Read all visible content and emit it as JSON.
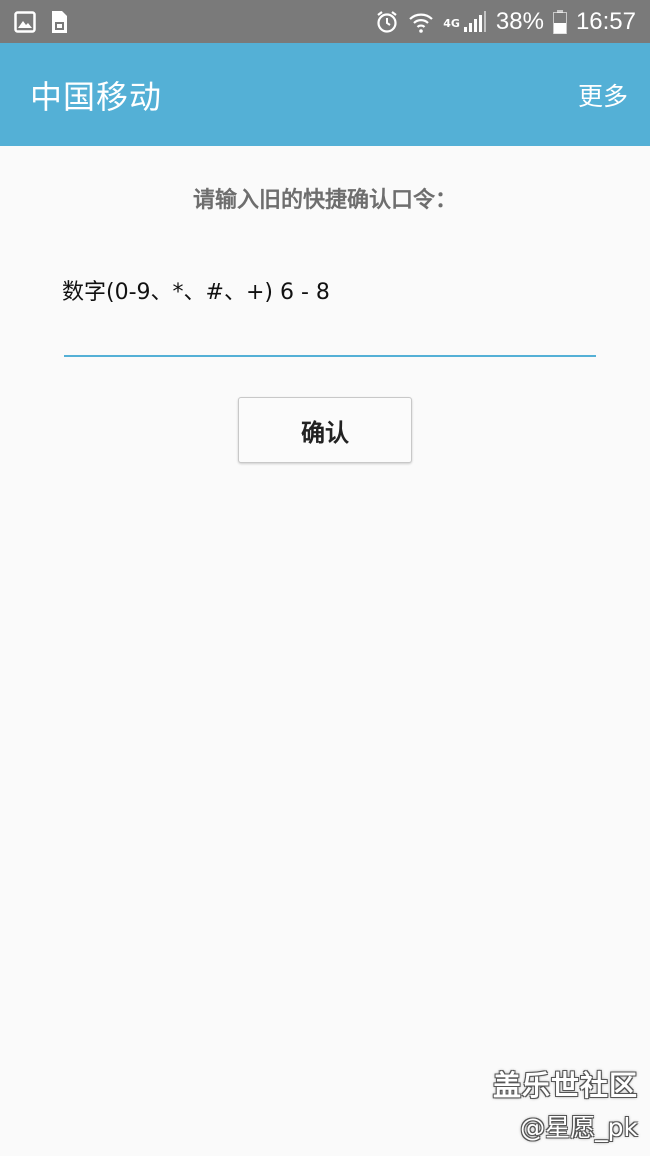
{
  "status_bar": {
    "network_type": "4G",
    "battery_percent": "38%",
    "time": "16:57",
    "icons": [
      "image-icon",
      "sim-icon",
      "alarm-icon",
      "wifi-icon",
      "signal-icon",
      "battery-icon"
    ]
  },
  "app_bar": {
    "title": "中国移动",
    "more_label": "更多",
    "color": "#54b0d6"
  },
  "form": {
    "prompt": "请输入旧的快捷确认口令：",
    "hint": "数字(0-9、*、#、+) 6 - 8",
    "input_value": "",
    "confirm_label": "确认"
  },
  "watermark": {
    "line1": "盖乐世社区",
    "line2": "@星愿_pk"
  }
}
